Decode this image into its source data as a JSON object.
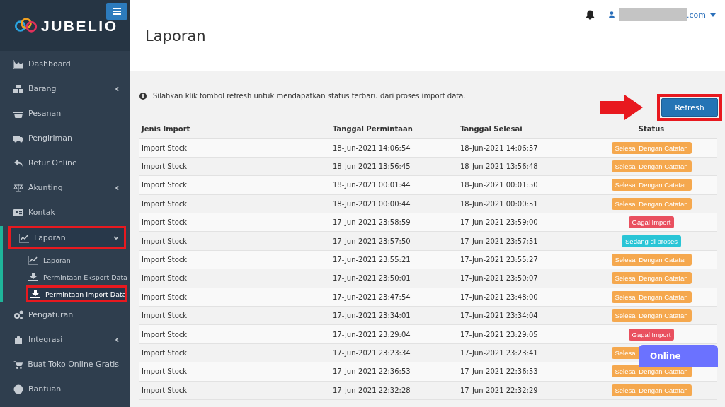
{
  "sidebar": {
    "logo": "JUBELIO",
    "items": [
      {
        "label": "Dashboard",
        "caret": false,
        "expanded": false,
        "highlighted": false
      },
      {
        "label": "Barang",
        "caret": true,
        "expanded": false,
        "highlighted": false
      },
      {
        "label": "Pesanan",
        "caret": false,
        "expanded": false,
        "highlighted": false
      },
      {
        "label": "Pengiriman",
        "caret": false,
        "expanded": false,
        "highlighted": false
      },
      {
        "label": "Retur Online",
        "caret": false,
        "expanded": false,
        "highlighted": false
      },
      {
        "label": "Akunting",
        "caret": true,
        "expanded": false,
        "highlighted": false
      },
      {
        "label": "Kontak",
        "caret": false,
        "expanded": false,
        "highlighted": false
      },
      {
        "label": "Laporan",
        "caret": true,
        "expanded": true,
        "highlighted": true,
        "children": [
          {
            "label": "Laporan",
            "selected": false,
            "highlighted": false
          },
          {
            "label": "Permintaan Eksport Data",
            "selected": false,
            "highlighted": false
          },
          {
            "label": "Permintaan Import Data",
            "selected": true,
            "highlighted": true
          }
        ]
      },
      {
        "label": "Pengaturan",
        "caret": false,
        "expanded": false,
        "highlighted": false
      },
      {
        "label": "Integrasi",
        "caret": true,
        "expanded": false,
        "highlighted": false
      },
      {
        "label": "Buat Toko Online Gratis",
        "caret": false,
        "expanded": false,
        "highlighted": false
      },
      {
        "label": "Bantuan",
        "caret": false,
        "expanded": false,
        "highlighted": false
      }
    ]
  },
  "header": {
    "user_email": ".com"
  },
  "page": {
    "title": "Laporan",
    "info": "Silahkan klik tombol refresh untuk mendapatkan status terbaru dari proses import data.",
    "refresh_button": "Refresh",
    "refresh_highlighted": true
  },
  "table": {
    "columns": [
      "Jenis Import",
      "Tanggal Permintaan",
      "Tanggal Selesai",
      "Status"
    ],
    "rows": [
      {
        "type": "Import Stock",
        "requested": "18-Jun-2021 14:06:54",
        "finished": "18-Jun-2021 14:06:57",
        "status": "Selesai Dengan Catatan",
        "kind": "warning"
      },
      {
        "type": "Import Stock",
        "requested": "18-Jun-2021 13:56:45",
        "finished": "18-Jun-2021 13:56:48",
        "status": "Selesai Dengan Catatan",
        "kind": "warning"
      },
      {
        "type": "Import Stock",
        "requested": "18-Jun-2021 00:01:44",
        "finished": "18-Jun-2021 00:01:50",
        "status": "Selesai Dengan Catatan",
        "kind": "warning"
      },
      {
        "type": "Import Stock",
        "requested": "18-Jun-2021 00:00:44",
        "finished": "18-Jun-2021 00:00:51",
        "status": "Selesai Dengan Catatan",
        "kind": "warning"
      },
      {
        "type": "Import Stock",
        "requested": "17-Jun-2021 23:58:59",
        "finished": "17-Jun-2021 23:59:00",
        "status": "Gagal Import",
        "kind": "danger"
      },
      {
        "type": "Import Stock",
        "requested": "17-Jun-2021 23:57:50",
        "finished": "17-Jun-2021 23:57:51",
        "status": "Sedang di proses",
        "kind": "info"
      },
      {
        "type": "Import Stock",
        "requested": "17-Jun-2021 23:55:21",
        "finished": "17-Jun-2021 23:55:27",
        "status": "Selesai Dengan Catatan",
        "kind": "warning"
      },
      {
        "type": "Import Stock",
        "requested": "17-Jun-2021 23:50:01",
        "finished": "17-Jun-2021 23:50:07",
        "status": "Selesai Dengan Catatan",
        "kind": "warning"
      },
      {
        "type": "Import Stock",
        "requested": "17-Jun-2021 23:47:54",
        "finished": "17-Jun-2021 23:48:00",
        "status": "Selesai Dengan Catatan",
        "kind": "warning"
      },
      {
        "type": "Import Stock",
        "requested": "17-Jun-2021 23:34:01",
        "finished": "17-Jun-2021 23:34:04",
        "status": "Selesai Dengan Catatan",
        "kind": "warning"
      },
      {
        "type": "Import Stock",
        "requested": "17-Jun-2021 23:29:04",
        "finished": "17-Jun-2021 23:29:05",
        "status": "Gagal Import",
        "kind": "danger"
      },
      {
        "type": "Import Stock",
        "requested": "17-Jun-2021 23:23:34",
        "finished": "17-Jun-2021 23:23:41",
        "status": "Selesai",
        "kind": "warning",
        "covered": true
      },
      {
        "type": "Import Stock",
        "requested": "17-Jun-2021 22:36:53",
        "finished": "17-Jun-2021 22:36:53",
        "status": "Selesai Dengan Catatan",
        "kind": "warning"
      },
      {
        "type": "Import Stock",
        "requested": "17-Jun-2021 22:32:28",
        "finished": "17-Jun-2021 22:32:29",
        "status": "Selesai Dengan Catatan",
        "kind": "warning"
      }
    ]
  },
  "chat_widget": {
    "label": "Online"
  }
}
